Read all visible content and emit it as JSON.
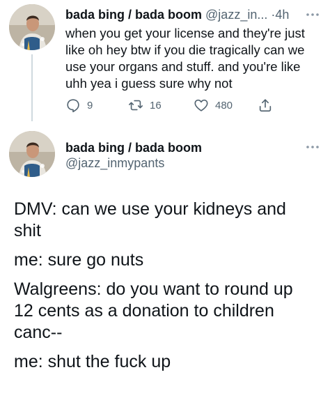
{
  "reply_tweet": {
    "display_name": "bada bing / bada boom",
    "handle_truncated": "@jazz_in...",
    "time_separator": "·",
    "timestamp": "4h",
    "avatar_icon": "user-avatar-photo",
    "more_icon": "more-dots-icon",
    "text_lines": [
      "when you get your license and they're just",
      "like oh hey btw if you die tragically can we",
      "use your organs and stuff. and you're like",
      "uhh yea i guess sure why not"
    ],
    "actions": {
      "reply_icon": "reply-icon",
      "reply_count": "9",
      "retweet_icon": "retweet-icon",
      "retweet_count": "16",
      "like_icon": "heart-icon",
      "like_count": "480",
      "share_icon": "share-icon"
    }
  },
  "main_tweet": {
    "display_name": "bada bing / bada boom",
    "handle": "@jazz_inmypants",
    "avatar_icon": "user-avatar-photo",
    "more_icon": "more-dots-icon",
    "paragraphs": [
      [
        "DMV: can we use your kidneys and",
        "shit"
      ],
      [
        "me: sure go nuts"
      ],
      [
        "Walgreens: do you want to round up",
        "12 cents as a donation to children",
        "canc--"
      ],
      [
        "me: shut the fuck up"
      ]
    ]
  },
  "colors": {
    "text": "#0f1419",
    "secondary": "#536471",
    "thread_line": "#cfd9de"
  }
}
